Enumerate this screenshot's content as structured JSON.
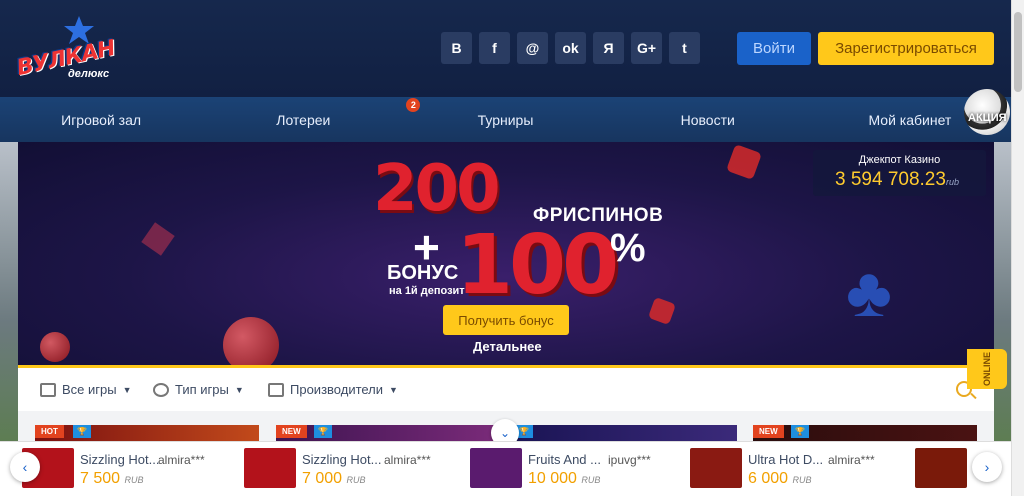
{
  "header": {
    "logo_text": "ВУЛКАН",
    "logo_sub": "делюкс",
    "socials": [
      {
        "label": "B",
        "icon": "vk-icon"
      },
      {
        "label": "f",
        "icon": "facebook-icon"
      },
      {
        "label": "@",
        "icon": "mail-icon"
      },
      {
        "label": "ok",
        "icon": "odnoklassniki-icon"
      },
      {
        "label": "Я",
        "icon": "yandex-icon"
      },
      {
        "label": "G+",
        "icon": "google-plus-icon"
      },
      {
        "label": "t",
        "icon": "twitter-icon"
      }
    ],
    "login_label": "Войти",
    "register_label": "Зарегистрироваться"
  },
  "nav": {
    "items": [
      {
        "label": "Игровой зал"
      },
      {
        "label": "Лотереи"
      },
      {
        "label": "Турниры",
        "badge": "2"
      },
      {
        "label": "Новости"
      },
      {
        "label": "Мой кабинет"
      }
    ],
    "promo_label": "АКЦИЯ"
  },
  "banner": {
    "big_number": "200",
    "freespins": "ФРИСПИНОВ",
    "plus": "+",
    "percent_number": "100",
    "percent_sign": "%",
    "bonus": "БОНУС",
    "deposit": "на 1й депозит",
    "cta_label": "Получить бонус",
    "more_label": "Детальнее"
  },
  "jackpot": {
    "title": "Джекпот Казино",
    "value": "3 594 708.23",
    "currency": "rub"
  },
  "filters": {
    "all_games": "Все игры",
    "game_type": "Тип игры",
    "providers": "Производители"
  },
  "online_label": "ONLINE",
  "games": {
    "cards": [
      {
        "badge": "HOT"
      },
      {
        "badge": "NEW"
      },
      {
        "badge": ""
      },
      {
        "badge": "NEW"
      }
    ]
  },
  "winners": [
    {
      "game": "Sizzling Hot...",
      "user": "almira***",
      "amount": "7 500",
      "currency": "RUB",
      "thumb_color": "#b3121b"
    },
    {
      "game": "Sizzling Hot...",
      "user": "almira***",
      "amount": "7 000",
      "currency": "RUB",
      "thumb_color": "#b3121b"
    },
    {
      "game": "Fruits And ...",
      "user": "ipuvg***",
      "amount": "10 000",
      "currency": "RUB",
      "thumb_color": "#5a1b6e"
    },
    {
      "game": "Ultra Hot D...",
      "user": "almira***",
      "amount": "6 000",
      "currency": "RUB",
      "thumb_color": "#8a1a12"
    }
  ],
  "colors": {
    "accent_yellow": "#ffc81a",
    "accent_blue": "#1a62c9",
    "promo_red": "#e0222e",
    "jackpot_gold": "#ffcb2e"
  }
}
